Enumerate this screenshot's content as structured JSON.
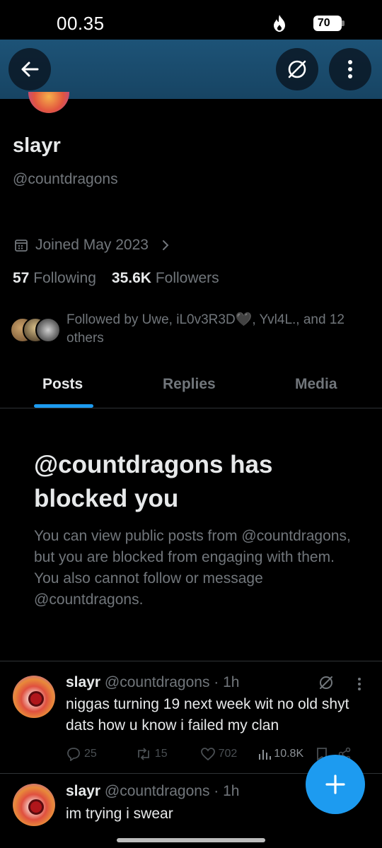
{
  "status_bar": {
    "time": "00.35",
    "battery": "70"
  },
  "profile": {
    "name": "slayr",
    "handle": "@countdragons",
    "joined": "Joined May 2023",
    "following_count": "57",
    "following_label": "Following",
    "followers_count": "35.6K",
    "followers_label": "Followers",
    "followed_by": "Followed by Uwe, iL0v3R3D🖤, Yvl4L., and 12 others"
  },
  "tabs": [
    {
      "label": "Posts",
      "active": true
    },
    {
      "label": "Replies",
      "active": false
    },
    {
      "label": "Media",
      "active": false
    }
  ],
  "blocked": {
    "title": "@countdragons has blocked you",
    "description": "You can view public posts from @countdragons, but you are blocked from engaging with them. You also cannot follow or message @countdragons."
  },
  "posts": [
    {
      "name": "slayr",
      "meta": "@countdragons · 1h",
      "text": "niggas turning 19 next week wit no old shyt dats how u know i failed my clan",
      "replies": "25",
      "reposts": "15",
      "likes": "702",
      "views": "10.8K"
    },
    {
      "name": "slayr",
      "meta": "@countdragons · 1h",
      "text": "im trying i swear"
    }
  ],
  "colors": {
    "accent": "#1d9bf0",
    "banner": "#1d5377",
    "muted": "#71767b"
  }
}
